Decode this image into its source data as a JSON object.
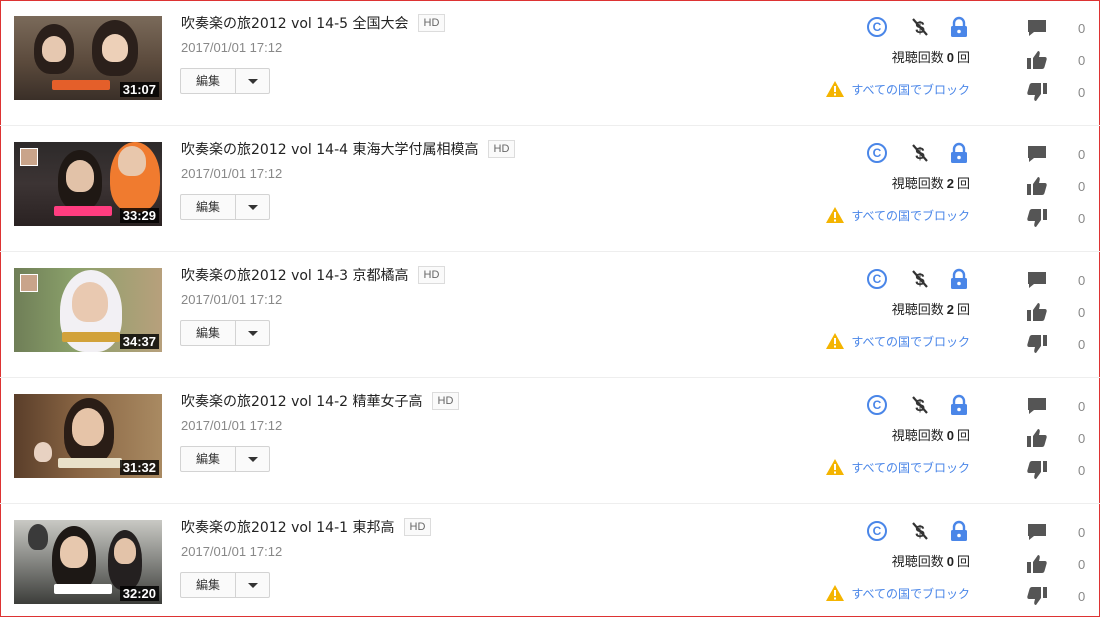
{
  "ui": {
    "edit_label": "編集",
    "views_prefix": "視聴回数",
    "views_suffix": "回",
    "block_text": "すべての国でブロック",
    "hd_label": "HD",
    "copyright_glyph": "C"
  },
  "colors": {
    "frame_border": "#dd3333",
    "link_blue": "#4a86e8",
    "warning_yellow": "#f4b400",
    "icon_dark": "#555555"
  },
  "icons": [
    "copyright-icon",
    "monetization-off-icon",
    "lock-icon",
    "warning-icon",
    "comment-icon",
    "thumbs-up-icon",
    "thumbs-down-icon",
    "dropdown-caret-icon"
  ],
  "videos": [
    {
      "title": "吹奏楽の旅2012 vol 14-5 全国大会",
      "hd": true,
      "date": "2017/01/01 17:12",
      "duration": "31:07",
      "views": "0",
      "comments": "0",
      "likes": "0",
      "dislikes": "0"
    },
    {
      "title": "吹奏楽の旅2012 vol 14-4 東海大学付属相模高",
      "hd": true,
      "date": "2017/01/01 17:12",
      "duration": "33:29",
      "views": "2",
      "comments": "0",
      "likes": "0",
      "dislikes": "0"
    },
    {
      "title": "吹奏楽の旅2012 vol 14-3 京都橘高",
      "hd": true,
      "date": "2017/01/01 17:12",
      "duration": "34:37",
      "views": "2",
      "comments": "0",
      "likes": "0",
      "dislikes": "0"
    },
    {
      "title": "吹奏楽の旅2012 vol 14-2 精華女子高",
      "hd": true,
      "date": "2017/01/01 17:12",
      "duration": "31:32",
      "views": "0",
      "comments": "0",
      "likes": "0",
      "dislikes": "0"
    },
    {
      "title": "吹奏楽の旅2012 vol 14-1 東邦高",
      "hd": true,
      "date": "2017/01/01 17:12",
      "duration": "32:20",
      "views": "0",
      "comments": "0",
      "likes": "0",
      "dislikes": "0"
    }
  ]
}
